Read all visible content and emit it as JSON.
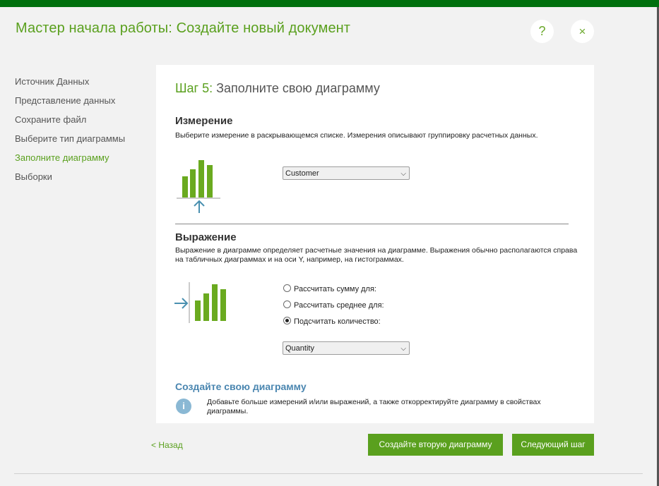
{
  "window": {
    "title": "Мастер начала работы: Создайте новый документ",
    "help_glyph": "?",
    "close_glyph": "×"
  },
  "sidebar": {
    "items": [
      {
        "label": "Источник Данных",
        "active": false
      },
      {
        "label": "Представление данных",
        "active": false
      },
      {
        "label": "Сохраните файл",
        "active": false
      },
      {
        "label": "Выберите тип диаграммы",
        "active": false
      },
      {
        "label": "Заполните диаграмму",
        "active": true
      },
      {
        "label": "Выборки",
        "active": false
      }
    ]
  },
  "step": {
    "number": "Шаг 5:",
    "title": "Заполните свою диаграмму"
  },
  "dimension": {
    "heading": "Измерение",
    "description": "Выберите измерение в раскрывающемся списке. Измерения описывают группировку расчетных данных.",
    "selected": "Customer"
  },
  "expression": {
    "heading": "Выражение",
    "description": "Выражение в диаграмме определяет расчетные значения на диаграмме. Выражения обычно располагаются справа на табличных диаграммах и на оси Y, например, на гистограммах.",
    "options": [
      {
        "label": "Рассчитать сумму для:",
        "checked": false
      },
      {
        "label": "Рассчитать среднее для:",
        "checked": false
      },
      {
        "label": "Подсчитать количество:",
        "checked": true
      }
    ],
    "selected": "Quantity"
  },
  "create_chart": {
    "heading": "Создайте свою диаграмму",
    "info_glyph": "i",
    "text": "Добавьте больше измерений и/или выражений, а также откорректируйте диаграмму в свойствах диаграммы."
  },
  "footer": {
    "back_label": "< Назад",
    "second_chart_label": "Создайте вторую диаграмму",
    "next_label": "Следующий шаг"
  },
  "colors": {
    "accent_green": "#5aa01e",
    "top_bar": "#00700e",
    "arrow_blue": "#4a90b0",
    "info_blue": "#8ab8d4"
  }
}
